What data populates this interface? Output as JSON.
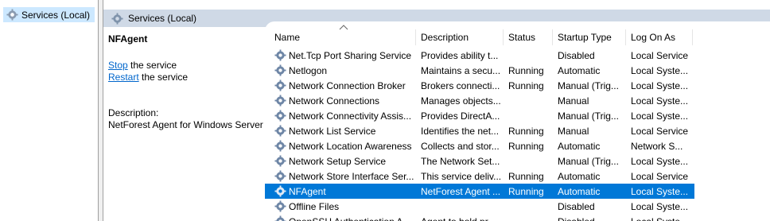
{
  "tree": {
    "item_label": "Services (Local)",
    "icon": "gear-icon"
  },
  "header": {
    "title": "Services (Local)",
    "icon": "gear-icon"
  },
  "extended": {
    "service_name": "NFAgent",
    "stop_link": "Stop",
    "stop_suffix": " the service",
    "restart_link": "Restart",
    "restart_suffix": " the service",
    "description_label": "Description:",
    "description_text": "NetForest Agent for Windows Server"
  },
  "columns": {
    "name": "Name",
    "description": "Description",
    "status": "Status",
    "startup": "Startup Type",
    "logon": "Log On As"
  },
  "rows": [
    {
      "name": "Net.Tcp Port Sharing Service",
      "description": "Provides ability t...",
      "status": "",
      "startup": "Disabled",
      "logon": "Local Service"
    },
    {
      "name": "Netlogon",
      "description": "Maintains a secu...",
      "status": "Running",
      "startup": "Automatic",
      "logon": "Local Syste..."
    },
    {
      "name": "Network Connection Broker",
      "description": "Brokers connecti...",
      "status": "Running",
      "startup": "Manual (Trig...",
      "logon": "Local Syste..."
    },
    {
      "name": "Network Connections",
      "description": "Manages objects...",
      "status": "",
      "startup": "Manual",
      "logon": "Local Syste..."
    },
    {
      "name": "Network Connectivity Assis...",
      "description": "Provides DirectA...",
      "status": "",
      "startup": "Manual (Trig...",
      "logon": "Local Syste..."
    },
    {
      "name": "Network List Service",
      "description": "Identifies the net...",
      "status": "Running",
      "startup": "Manual",
      "logon": "Local Service"
    },
    {
      "name": "Network Location Awareness",
      "description": "Collects and stor...",
      "status": "Running",
      "startup": "Automatic",
      "logon": "Network S..."
    },
    {
      "name": "Network Setup Service",
      "description": "The Network Set...",
      "status": "",
      "startup": "Manual (Trig...",
      "logon": "Local Syste..."
    },
    {
      "name": "Network Store Interface Ser...",
      "description": "This service deliv...",
      "status": "Running",
      "startup": "Automatic",
      "logon": "Local Service"
    },
    {
      "name": "NFAgent",
      "description": "NetForest Agent ...",
      "status": "Running",
      "startup": "Automatic",
      "logon": "Local Syste...",
      "selected": true
    },
    {
      "name": "Offline Files",
      "description": "",
      "status": "",
      "startup": "Disabled",
      "logon": "Local Syste..."
    },
    {
      "name": "OpenSSH Authentication A...",
      "description": "Agent to hold pr...",
      "status": "",
      "startup": "Disabled",
      "logon": "Local Syste..."
    }
  ],
  "colors": {
    "selection": "#0078d7",
    "link": "#0066cc",
    "header_bar": "#cfd9e6",
    "tree_selection": "#cce8ff"
  }
}
